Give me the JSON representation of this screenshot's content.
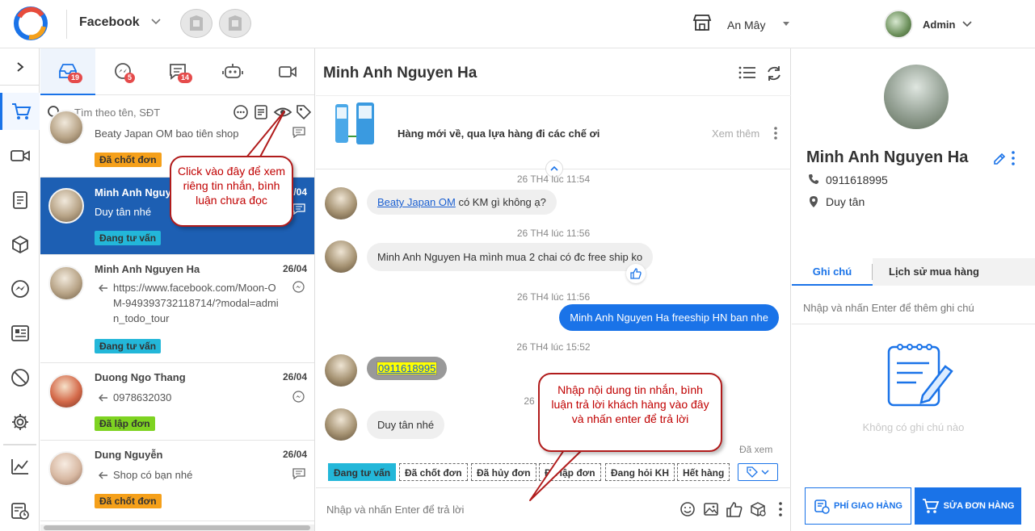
{
  "topbar": {
    "page_name": "Facebook",
    "store_name": "An Mây",
    "user_name": "Admin"
  },
  "convlist": {
    "tabs": [
      {
        "icon": "inbox-icon",
        "badge": "19"
      },
      {
        "icon": "messenger-icon",
        "badge": "5"
      },
      {
        "icon": "comment-icon",
        "badge": "14"
      },
      {
        "icon": "bot-icon",
        "badge": ""
      },
      {
        "icon": "video-icon",
        "badge": ""
      }
    ],
    "search_placeholder": "Tìm theo tên, SĐT",
    "items": [
      {
        "name": "",
        "date": "",
        "message": "Beaty Japan OM bao tiên shop",
        "tag": "Đã chốt đơn"
      },
      {
        "name": "Minh Anh Nguyen Ha",
        "date": "26/04",
        "message": "Duy tân nhé",
        "tag": "Đang tư vấn"
      },
      {
        "name": "Minh Anh Nguyen Ha",
        "date": "26/04",
        "message": "https://www.facebook.com/Moon-OM-949393732118714/?modal=admin_todo_tour",
        "tag": "Đang tư vấn"
      },
      {
        "name": "Duong Ngo Thang",
        "date": "26/04",
        "message": "0978632030",
        "tag": "Đã lập đơn"
      },
      {
        "name": "Dung Nguyễn",
        "date": "26/04",
        "message": "Shop có bạn nhé",
        "tag": "Đã chốt đơn"
      }
    ]
  },
  "callouts": {
    "eye": "Click vào đây để xem riêng tin nhắn, bình luận chưa đọc",
    "reply": "Nhập nội dung tin nhắn, bình luận trả lời khách hàng vào đây và nhấn enter để trả lời"
  },
  "chat": {
    "title": "Minh Anh Nguyen Ha",
    "promo_text": "Hàng mới về, qua lựa hàng đi các chế ơi",
    "promo_more": "Xem thêm",
    "messages": [
      {
        "time": "26 TH4 lúc 11:54",
        "link": "Beaty Japan OM",
        "text": "có KM gì không ạ?"
      },
      {
        "time": "26 TH4 lúc 11:56",
        "text": "Minh Anh Nguyen Ha mình mua 2 chai có đc free ship ko"
      },
      {
        "time": "26 TH4 lúc 11:56",
        "text": "Minh Anh Nguyen Ha freeship HN ban nhe"
      },
      {
        "time": "26 TH4 lúc 15:52",
        "text": "0911618995"
      },
      {
        "time": "26",
        "text": "Duy tân nhé"
      }
    ],
    "seen": "Đã xem",
    "status_tags": [
      "Đang tư vấn",
      "Đã chốt đơn",
      "Đã hủy đơn",
      "Đã lập đơn",
      "Đang hỏi KH",
      "Hết hàng"
    ],
    "reply_placeholder": "Nhập và nhấn Enter để trả lời"
  },
  "profile": {
    "name": "Minh Anh Nguyen Ha",
    "phone": "0911618995",
    "address": "Duy tân",
    "tabs": [
      "Ghi chú",
      "Lịch sử mua hàng"
    ],
    "note_placeholder": "Nhập và nhấn Enter để thêm ghi chú",
    "empty_text": "Không có ghi chú nào",
    "ship_button": "PHÍ GIAO HÀNG",
    "edit_button": "SỬA ĐƠN HÀNG"
  },
  "colors": {
    "accent": "#1a73e8",
    "selected_row": "#1d5fb3",
    "tag_orange": "#f5a01a",
    "tag_cyan": "#23b7d9",
    "tag_green": "#7ed321",
    "callout_red": "#b11c1c"
  }
}
